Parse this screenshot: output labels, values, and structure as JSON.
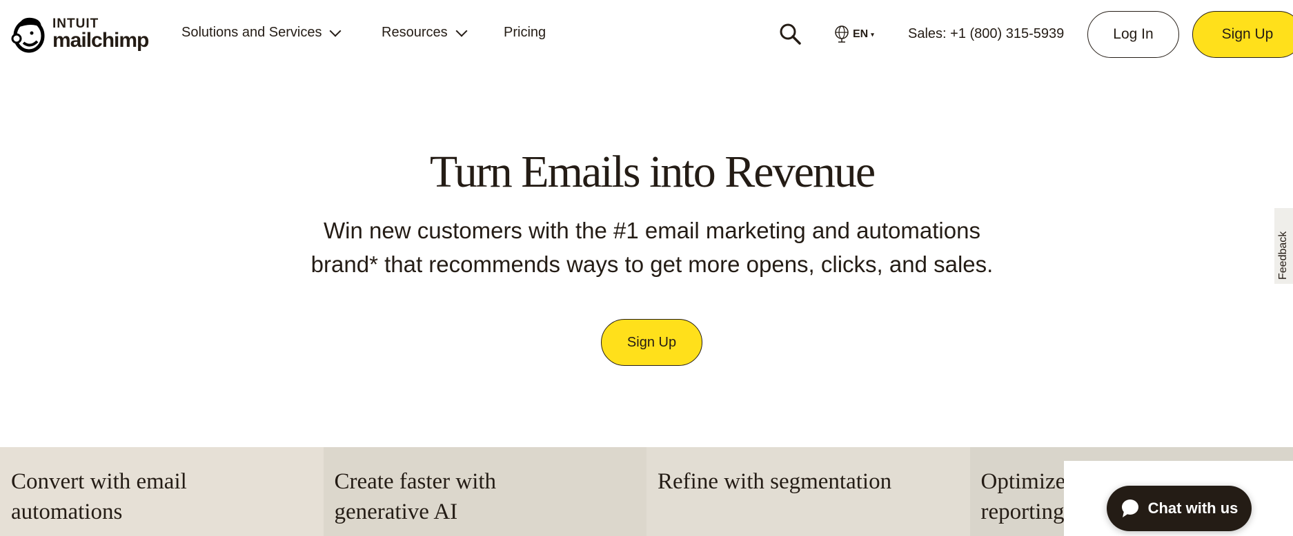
{
  "nav": {
    "logo_top": "INTUIT",
    "logo_bottom": "mailchimp",
    "items": [
      {
        "label": "Solutions and Services",
        "has_dropdown": true
      },
      {
        "label": "Resources",
        "has_dropdown": true
      },
      {
        "label": "Pricing",
        "has_dropdown": false
      }
    ],
    "search_icon": "search-icon",
    "language": "EN",
    "sales": "Sales: +1 (800) 315-5939",
    "login": "Log In",
    "signup": "Sign Up"
  },
  "hero": {
    "title": "Turn Emails into Revenue",
    "subtitle_line1": "Win new customers with the #1 email marketing and automations",
    "subtitle_line2": "brand* that recommends ways to get more opens, clicks, and sales.",
    "signup": "Sign Up"
  },
  "cards": [
    {
      "title_line1": "Convert with email",
      "title_line2": "automations"
    },
    {
      "title_line1": "Create faster with",
      "title_line2": "generative AI"
    },
    {
      "title_line1": "Refine with segmentation",
      "title_line2": ""
    },
    {
      "title_line1": "Optimize with",
      "title_line2": "reporting"
    }
  ],
  "feedback": "Feedback",
  "chat": "Chat with us",
  "colors": {
    "accent": "#ffe01b",
    "text": "#241c15"
  }
}
